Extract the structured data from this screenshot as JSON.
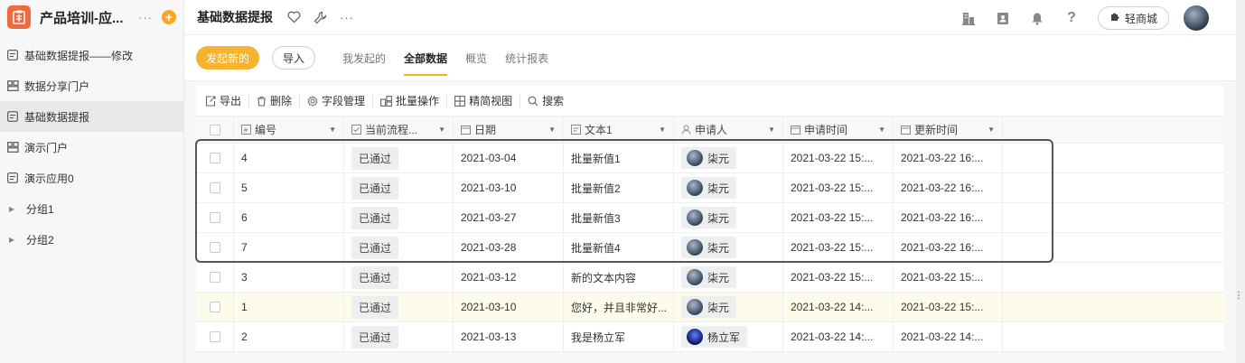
{
  "app": {
    "title": "产品培训-应...",
    "more": "···",
    "add": "+"
  },
  "sidebar": {
    "items": [
      {
        "label": "基础数据提报——修改",
        "icon": "form-icon"
      },
      {
        "label": "数据分享门户",
        "icon": "portal-icon"
      },
      {
        "label": "基础数据提报",
        "icon": "form-icon",
        "active": true
      },
      {
        "label": "演示门户",
        "icon": "portal-icon"
      },
      {
        "label": "演示应用0",
        "icon": "form-icon"
      }
    ],
    "groups": [
      {
        "label": "分组1"
      },
      {
        "label": "分组2"
      }
    ]
  },
  "header": {
    "title": "基础数据提报",
    "mall_label": "轻商城",
    "more": "···"
  },
  "tabsbar": {
    "primary_button": "发起新的",
    "import_button": "导入",
    "tabs": [
      {
        "label": "我发起的"
      },
      {
        "label": "全部数据",
        "active": true
      },
      {
        "label": "概览"
      },
      {
        "label": "统计报表"
      }
    ]
  },
  "toolbar": {
    "export": "导出",
    "delete": "删除",
    "fields": "字段管理",
    "batch": "批量操作",
    "view": "精简视图",
    "search": "搜索"
  },
  "table": {
    "columns": [
      "编号",
      "当前流程...",
      "日期",
      "文本1",
      "申请人",
      "申请时间",
      "更新时间"
    ],
    "rows": [
      {
        "id": "4",
        "status": "已通过",
        "date": "2021-03-04",
        "text": "批量新值1",
        "user": "柒元",
        "applied": "2021-03-22 15:...",
        "updated": "2021-03-22 16:..."
      },
      {
        "id": "5",
        "status": "已通过",
        "date": "2021-03-10",
        "text": "批量新值2",
        "user": "柒元",
        "applied": "2021-03-22 15:...",
        "updated": "2021-03-22 16:..."
      },
      {
        "id": "6",
        "status": "已通过",
        "date": "2021-03-27",
        "text": "批量新值3",
        "user": "柒元",
        "applied": "2021-03-22 15:...",
        "updated": "2021-03-22 16:..."
      },
      {
        "id": "7",
        "status": "已通过",
        "date": "2021-03-28",
        "text": "批量新值4",
        "user": "柒元",
        "applied": "2021-03-22 15:...",
        "updated": "2021-03-22 16:..."
      },
      {
        "id": "3",
        "status": "已通过",
        "date": "2021-03-12",
        "text": "新的文本内容",
        "user": "柒元",
        "applied": "2021-03-22 15:...",
        "updated": "2021-03-22 15:..."
      },
      {
        "id": "1",
        "status": "已通过",
        "date": "2021-03-10",
        "text": "您好，并且非常好...",
        "user": "柒元",
        "applied": "2021-03-22 14:...",
        "updated": "2021-03-22 15:...",
        "highlight": true
      },
      {
        "id": "2",
        "status": "已通过",
        "date": "2021-03-13",
        "text": "我是杨立军",
        "user": "杨立军",
        "user_avatar": "blue",
        "applied": "2021-03-22 14:...",
        "updated": "2021-03-22 14:..."
      }
    ]
  },
  "colors": {
    "accent": "#f5b32f",
    "brand": "#ef6a3c",
    "add": "#f6a623"
  }
}
